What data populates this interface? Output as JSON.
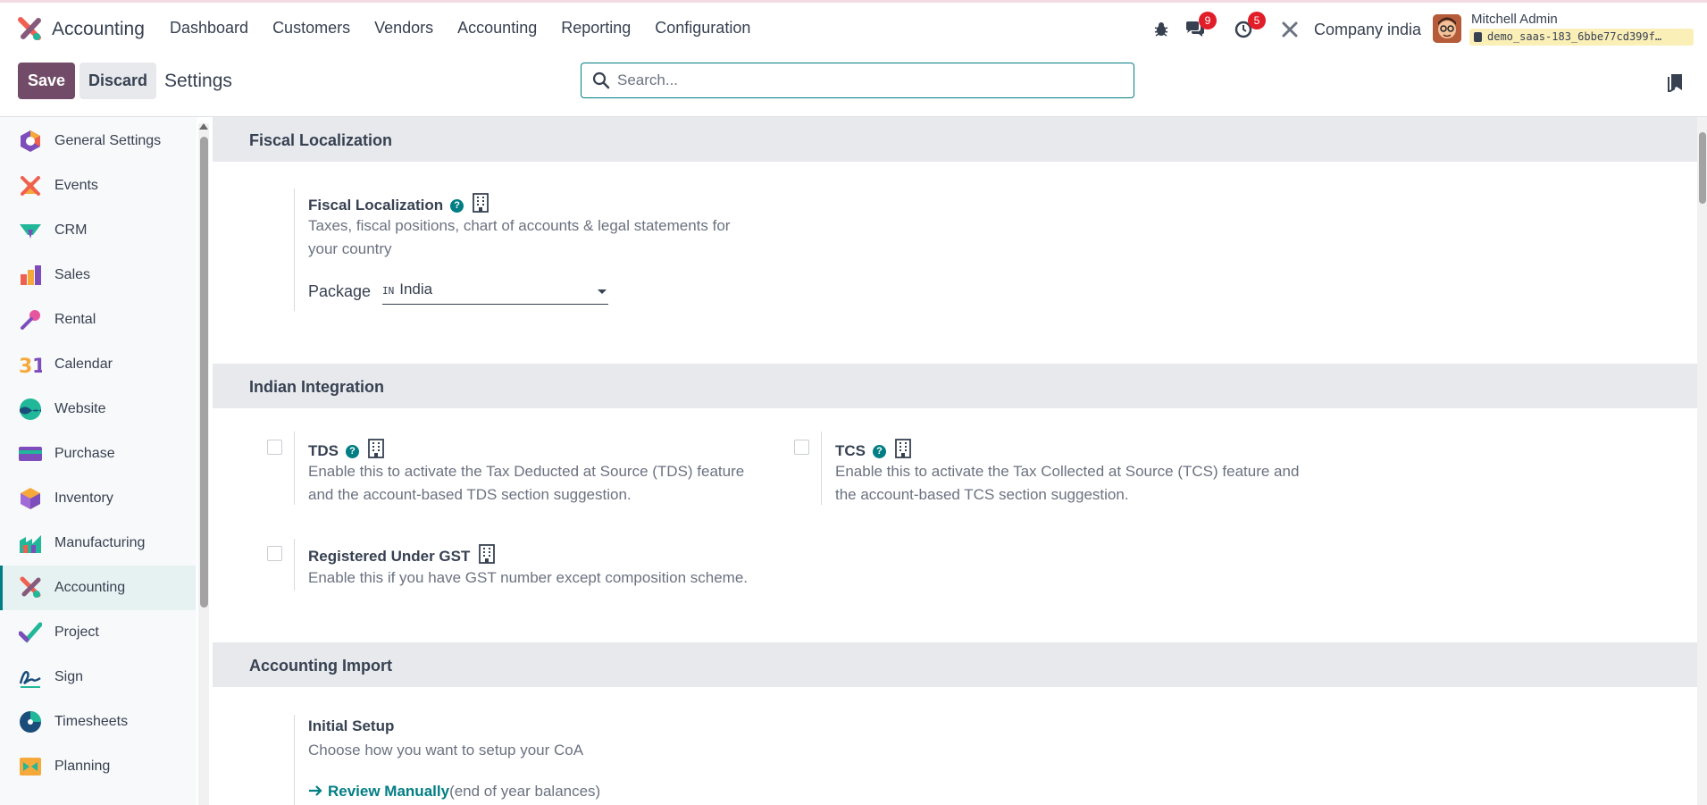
{
  "app": {
    "name": "Accounting"
  },
  "menu": [
    "Dashboard",
    "Customers",
    "Vendors",
    "Accounting",
    "Reporting",
    "Configuration"
  ],
  "systray": {
    "messages_count": "9",
    "activities_count": "5",
    "company": "Company india",
    "user_name": "Mitchell Admin",
    "db_name": "demo_saas-183_6bbe77cd399f…"
  },
  "control": {
    "save": "Save",
    "discard": "Discard",
    "title": "Settings",
    "search_placeholder": "Search..."
  },
  "sidebar": {
    "items": [
      {
        "label": "General Settings",
        "icon": "general-settings-icon",
        "active": false
      },
      {
        "label": "Events",
        "icon": "events-icon",
        "active": false
      },
      {
        "label": "CRM",
        "icon": "crm-icon",
        "active": false
      },
      {
        "label": "Sales",
        "icon": "sales-icon",
        "active": false
      },
      {
        "label": "Rental",
        "icon": "rental-icon",
        "active": false
      },
      {
        "label": "Calendar",
        "icon": "calendar-icon",
        "active": false
      },
      {
        "label": "Website",
        "icon": "website-icon",
        "active": false
      },
      {
        "label": "Purchase",
        "icon": "purchase-icon",
        "active": false
      },
      {
        "label": "Inventory",
        "icon": "inventory-icon",
        "active": false
      },
      {
        "label": "Manufacturing",
        "icon": "manufacturing-icon",
        "active": false
      },
      {
        "label": "Accounting",
        "icon": "accounting-icon",
        "active": true
      },
      {
        "label": "Project",
        "icon": "project-icon",
        "active": false
      },
      {
        "label": "Sign",
        "icon": "sign-icon",
        "active": false
      },
      {
        "label": "Timesheets",
        "icon": "timesheets-icon",
        "active": false
      },
      {
        "label": "Planning",
        "icon": "planning-icon",
        "active": false
      }
    ]
  },
  "sections": {
    "fiscal": {
      "heading": "Fiscal Localization",
      "setting_title": "Fiscal Localization",
      "setting_desc": "Taxes, fiscal positions, chart of accounts & legal statements for your country",
      "package_label": "Package",
      "package_flag": "IN",
      "package_value": "India"
    },
    "indian": {
      "heading": "Indian Integration",
      "tds_title": "TDS",
      "tds_desc": "Enable this to activate the Tax Deducted at Source (TDS) feature and the account-based TDS section suggestion.",
      "tcs_title": "TCS",
      "tcs_desc": "Enable this to activate the Tax Collected at Source (TCS) feature and the account-based TCS section suggestion.",
      "gst_title": "Registered Under GST",
      "gst_desc": "Enable this if you have GST number except composition scheme."
    },
    "import": {
      "heading": "Accounting Import",
      "setting_title": "Initial Setup",
      "setting_desc": "Choose how you want to setup your CoA",
      "review_link": "Review Manually",
      "review_note": "(end of year balances)"
    }
  }
}
